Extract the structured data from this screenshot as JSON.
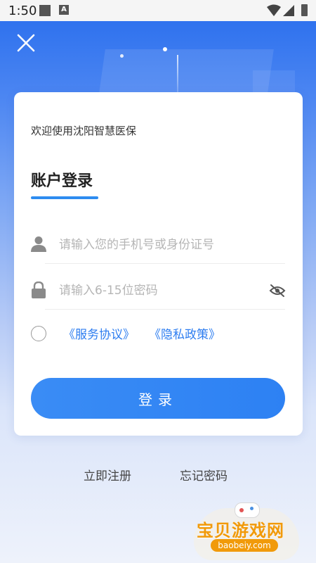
{
  "status_bar": {
    "time": "1:50"
  },
  "header": {
    "close_icon": "close-icon"
  },
  "card": {
    "welcome_text": "欢迎使用沈阳智慧医保",
    "tab_title": "账户登录",
    "phone_field": {
      "placeholder": "请输入您的手机号或身份证号",
      "value": "",
      "icon": "user-icon"
    },
    "password_field": {
      "placeholder": "请输入6-15位密码",
      "value": "",
      "icon": "lock-icon",
      "toggle_icon": "eye-off-icon"
    },
    "agreement": {
      "checked": false,
      "service_link": "《服务协议》",
      "privacy_link": "《隐私政策》"
    },
    "login_button": "登录"
  },
  "footer": {
    "register_link": "立即注册",
    "forgot_link": "忘记密码"
  },
  "watermark": {
    "title": "宝贝游戏网",
    "site": "baobeiy.com"
  },
  "colors": {
    "accent": "#2d8cf0",
    "link": "#2d7df0",
    "hero_top": "#2f72ee"
  }
}
